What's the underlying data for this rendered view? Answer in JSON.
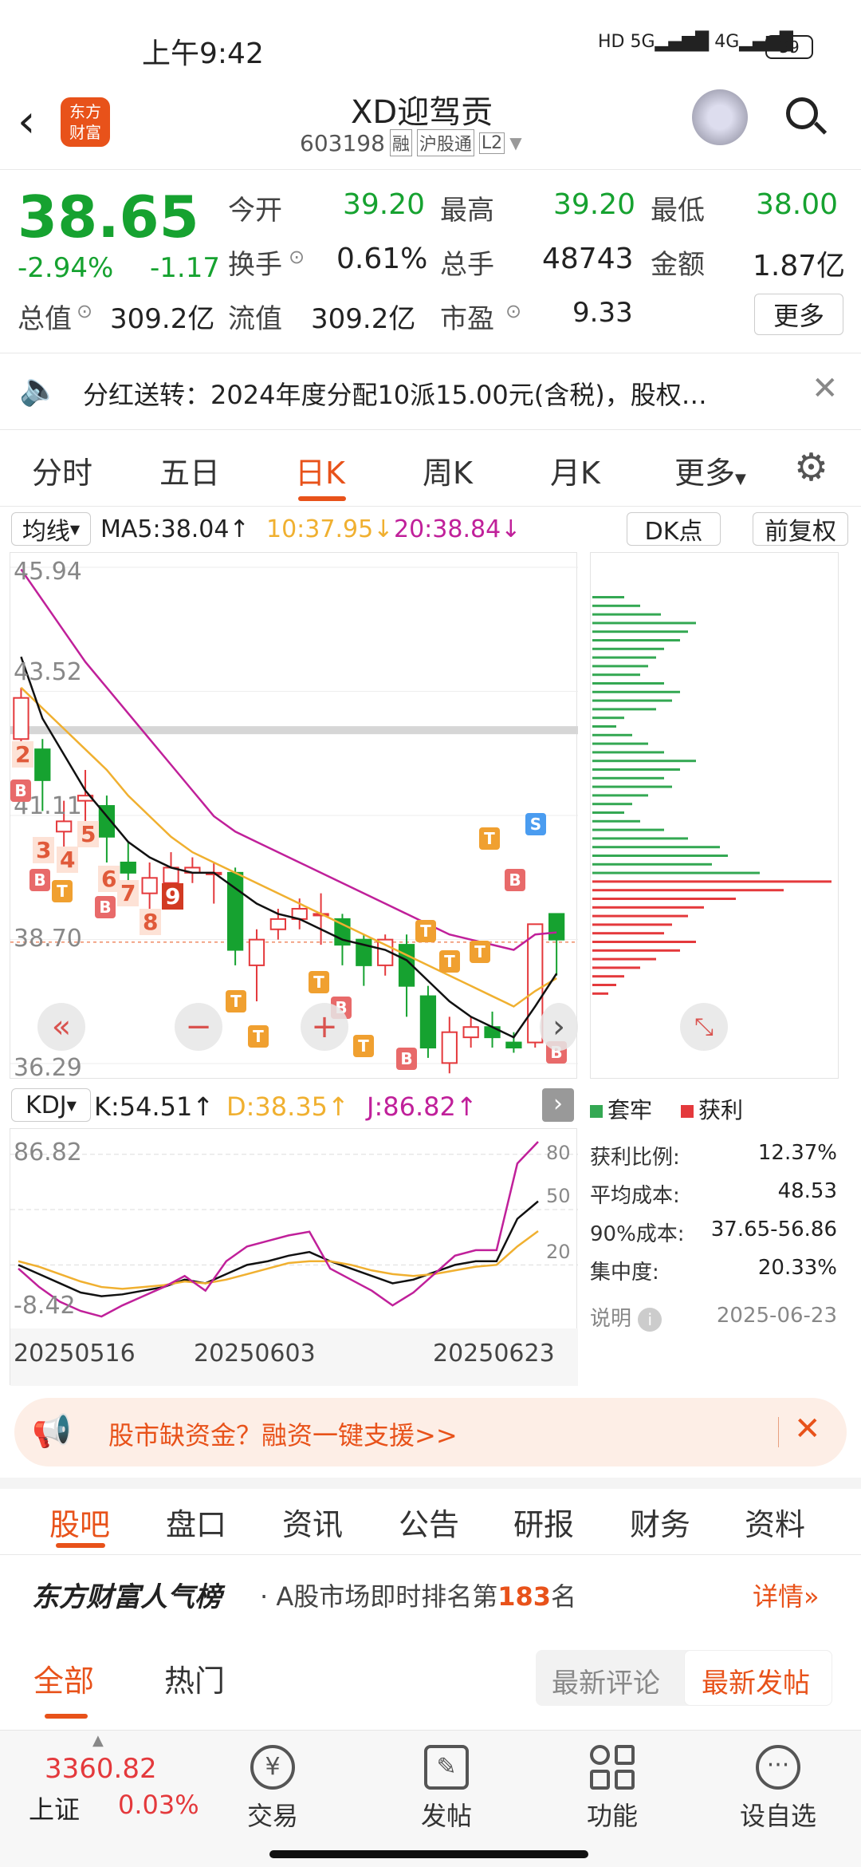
{
  "status_bar": {
    "time": "上午9:42",
    "signal": "5G 4G",
    "battery": "39"
  },
  "header": {
    "title": "XD迎驾贡",
    "code": "603198",
    "tags": [
      "融",
      "沪股通",
      "L2"
    ],
    "logo": "东方财富"
  },
  "quote": {
    "price": "38.65",
    "change_pct": "-2.94%",
    "change": "-1.17",
    "open_label": "今开",
    "open": "39.20",
    "high_label": "最高",
    "high": "39.20",
    "low_label": "最低",
    "low": "38.00",
    "turnover_label": "换手",
    "turnover": "0.61%",
    "volume_label": "总手",
    "volume": "48743",
    "amount_label": "金额",
    "amount": "1.87亿",
    "mktcap_label": "总值",
    "mktcap": "309.2亿",
    "float_label": "流值",
    "float": "309.2亿",
    "pe_label": "市盈",
    "pe": "9.33",
    "more": "更多"
  },
  "notice": {
    "text": "分红送转：2024年度分配10派15.00元(含税)，股权…"
  },
  "chart_tabs": [
    "分时",
    "五日",
    "日K",
    "周K",
    "月K",
    "更多"
  ],
  "active_tab": "日K",
  "ma_bar": {
    "selector": "均线",
    "ma5": "MA5:38.04",
    "ma10": "10:37.95",
    "ma20": "20:38.84",
    "dk": "DK点",
    "adjust": "前复权"
  },
  "kdj_bar": {
    "selector": "KDJ",
    "k": "K:54.51",
    "d": "D:38.35",
    "j": "J:86.82"
  },
  "chart_data": [
    {
      "type": "candlestick",
      "yticks": [
        "45.94",
        "43.52",
        "41.11",
        "38.70",
        "36.29"
      ],
      "ylim": [
        36.29,
        45.94
      ],
      "candles": [
        {
          "o": 42.6,
          "c": 43.4,
          "h": 43.6,
          "l": 42.4
        },
        {
          "o": 42.4,
          "c": 41.8,
          "h": 42.6,
          "l": 41.2
        },
        {
          "o": 40.8,
          "c": 41.0,
          "h": 41.4,
          "l": 40.4
        },
        {
          "o": 41.4,
          "c": 41.5,
          "h": 42.0,
          "l": 41.0
        },
        {
          "o": 41.3,
          "c": 40.7,
          "h": 41.5,
          "l": 40.2
        },
        {
          "o": 40.2,
          "c": 40.0,
          "h": 40.6,
          "l": 39.6
        },
        {
          "o": 39.6,
          "c": 39.9,
          "h": 40.2,
          "l": 39.2
        },
        {
          "o": 39.8,
          "c": 40.1,
          "h": 40.4,
          "l": 39.6
        },
        {
          "o": 40.0,
          "c": 40.1,
          "h": 40.3,
          "l": 39.8
        },
        {
          "o": 40.0,
          "c": 40.0,
          "h": 40.2,
          "l": 39.4
        },
        {
          "o": 40.0,
          "c": 38.5,
          "h": 40.1,
          "l": 38.2
        },
        {
          "o": 38.2,
          "c": 38.7,
          "h": 38.9,
          "l": 37.5
        },
        {
          "o": 38.9,
          "c": 39.1,
          "h": 39.3,
          "l": 38.7
        },
        {
          "o": 39.1,
          "c": 39.3,
          "h": 39.5,
          "l": 38.9
        },
        {
          "o": 39.2,
          "c": 39.2,
          "h": 39.6,
          "l": 38.6
        },
        {
          "o": 39.1,
          "c": 38.6,
          "h": 39.2,
          "l": 38.2
        },
        {
          "o": 38.7,
          "c": 38.2,
          "h": 38.8,
          "l": 37.8
        },
        {
          "o": 38.2,
          "c": 38.7,
          "h": 38.8,
          "l": 38.0
        },
        {
          "o": 38.6,
          "c": 37.8,
          "h": 38.8,
          "l": 37.2
        },
        {
          "o": 37.6,
          "c": 36.6,
          "h": 37.8,
          "l": 36.4
        },
        {
          "o": 36.3,
          "c": 36.9,
          "h": 37.2,
          "l": 36.1
        },
        {
          "o": 36.8,
          "c": 37.0,
          "h": 37.2,
          "l": 36.6
        },
        {
          "o": 37.0,
          "c": 36.8,
          "h": 37.3,
          "l": 36.6
        },
        {
          "o": 36.7,
          "c": 36.6,
          "h": 36.9,
          "l": 36.5
        },
        {
          "o": 36.7,
          "c": 39.0,
          "h": 39.0,
          "l": 36.6
        },
        {
          "o": 39.2,
          "c": 38.7,
          "h": 39.2,
          "l": 38.0
        }
      ],
      "ma5": [
        44.2,
        43.0,
        42.3,
        41.6,
        41.1,
        40.6,
        40.3,
        40.1,
        40.0,
        40.0,
        39.7,
        39.4,
        39.2,
        39.1,
        38.9,
        38.7,
        38.6,
        38.5,
        38.3,
        37.9,
        37.5,
        37.2,
        37.0,
        36.8,
        37.4,
        38.04
      ],
      "ma10": [
        43.6,
        43.2,
        42.8,
        42.4,
        42.0,
        41.5,
        41.1,
        40.7,
        40.4,
        40.2,
        40.0,
        39.8,
        39.6,
        39.4,
        39.2,
        39.0,
        38.8,
        38.6,
        38.4,
        38.2,
        38.0,
        37.8,
        37.6,
        37.4,
        37.7,
        37.95
      ],
      "ma20": [
        45.9,
        45.3,
        44.7,
        44.1,
        43.6,
        43.1,
        42.6,
        42.1,
        41.6,
        41.1,
        40.8,
        40.6,
        40.4,
        40.2,
        40.0,
        39.8,
        39.6,
        39.4,
        39.2,
        39.0,
        38.8,
        38.7,
        38.6,
        38.5,
        38.8,
        38.84
      ]
    },
    {
      "type": "line",
      "title": "KDJ",
      "yticks_left": [
        "86.82",
        "-8.42"
      ],
      "yticks_right": [
        "80",
        "50",
        "20"
      ],
      "ylim": [
        -8.42,
        86.82
      ],
      "x_labels": [
        "20250516",
        "20250603",
        "20250623"
      ],
      "series": [
        {
          "name": "K",
          "values": [
            20,
            15,
            10,
            5,
            3,
            4,
            6,
            8,
            12,
            10,
            15,
            20,
            22,
            25,
            27,
            22,
            18,
            14,
            10,
            12,
            16,
            20,
            22,
            22,
            45,
            54.51
          ]
        },
        {
          "name": "D",
          "values": [
            22,
            19,
            15,
            11,
            8,
            7,
            8,
            9,
            11,
            10,
            12,
            15,
            18,
            21,
            22,
            22,
            20,
            17,
            15,
            14,
            15,
            17,
            19,
            20,
            30,
            38.35
          ]
        },
        {
          "name": "J",
          "values": [
            18,
            8,
            0,
            -5,
            -8,
            -2,
            3,
            8,
            14,
            6,
            22,
            30,
            33,
            36,
            38,
            18,
            12,
            6,
            -2,
            5,
            15,
            25,
            28,
            28,
            75,
            86.82
          ]
        }
      ]
    }
  ],
  "chart_markers": {
    "numbers": [
      "2",
      "3",
      "4",
      "5",
      "6",
      "7",
      "8",
      "9"
    ],
    "b": "B",
    "t": "T",
    "s": "S"
  },
  "chip_panel": {
    "legend_trapped": "套牢",
    "legend_profit": "获利",
    "rows": [
      {
        "label": "获利比例:",
        "value": "12.37%"
      },
      {
        "label": "平均成本:",
        "value": "48.53"
      },
      {
        "label": "90%成本:",
        "value": "37.65-56.86"
      },
      {
        "label": "集中度:",
        "value": "20.33%"
      }
    ],
    "note": "说明",
    "date": "2025-06-23"
  },
  "banner": {
    "text": "股市缺资金？融资一键支援>>"
  },
  "content_tabs": [
    "股吧",
    "盘口",
    "资讯",
    "公告",
    "研报",
    "财务",
    "资料"
  ],
  "content_active": "股吧",
  "ranking": {
    "brand": "东方财富人气榜",
    "text_pre": "A股市场即时排名第",
    "rank": "183",
    "text_post": "名",
    "detail": "详情"
  },
  "filter": {
    "all": "全部",
    "hot": "热门",
    "latest_comment": "最新评论",
    "latest_post": "最新发帖"
  },
  "bottom_nav": {
    "index_value": "3360.82",
    "index_name": "上证",
    "index_change": "0.03%",
    "items": [
      "交易",
      "发帖",
      "功能",
      "设自选"
    ]
  },
  "colors": {
    "up": "#e4393c",
    "down": "#16a230",
    "ma10": "#f0b030",
    "ma20": "#c0209a",
    "accent": "#e8521a"
  }
}
